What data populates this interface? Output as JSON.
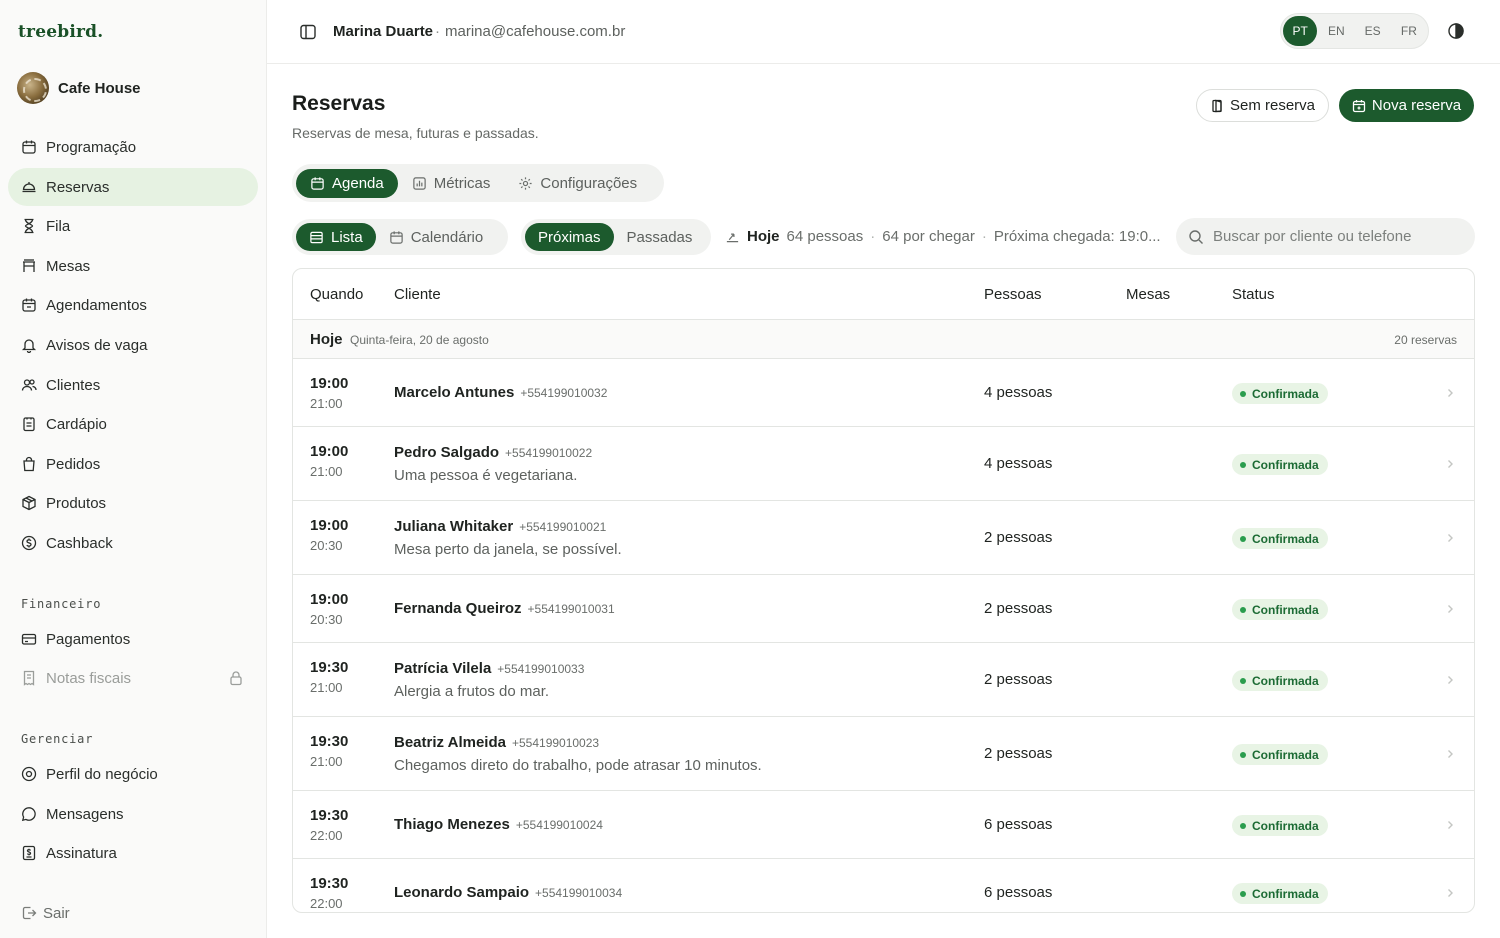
{
  "brand": {
    "logo": "treebird.",
    "business": "Cafe House"
  },
  "user": {
    "name": "Marina Duarte",
    "separator": "·",
    "email": "marina@cafehouse.com.br"
  },
  "languages": [
    {
      "code": "PT",
      "active": true
    },
    {
      "code": "EN",
      "active": false
    },
    {
      "code": "ES",
      "active": false
    },
    {
      "code": "FR",
      "active": false
    }
  ],
  "sidebar": {
    "items": [
      {
        "label": "Programação",
        "icon": "calendar-icon"
      },
      {
        "label": "Reservas",
        "icon": "reservation-icon",
        "active": true
      },
      {
        "label": "Fila",
        "icon": "hourglass-icon"
      },
      {
        "label": "Mesas",
        "icon": "table-icon"
      },
      {
        "label": "Agendamentos",
        "icon": "calendar-clock-icon"
      },
      {
        "label": "Avisos de vaga",
        "icon": "bell-icon"
      },
      {
        "label": "Clientes",
        "icon": "users-icon"
      },
      {
        "label": "Cardápio",
        "icon": "menu-book-icon"
      },
      {
        "label": "Pedidos",
        "icon": "shopping-bag-icon"
      },
      {
        "label": "Produtos",
        "icon": "box-icon"
      },
      {
        "label": "Cashback",
        "icon": "cashback-icon"
      }
    ],
    "finance_label": "Financeiro",
    "finance_items": [
      {
        "label": "Pagamentos",
        "icon": "credit-card-icon"
      },
      {
        "label": "Notas fiscais",
        "icon": "receipt-icon",
        "locked": true
      }
    ],
    "manage_label": "Gerenciar",
    "manage_items": [
      {
        "label": "Perfil do negócio",
        "icon": "location-pin-icon"
      },
      {
        "label": "Mensagens",
        "icon": "chat-icon"
      },
      {
        "label": "Assinatura",
        "icon": "subscription-icon"
      }
    ],
    "logout_label": "Sair"
  },
  "header": {
    "title": "Reservas",
    "subtitle": "Reservas de mesa, futuras e passadas.",
    "walkin_label": "Sem reserva",
    "new_label": "Nova reserva"
  },
  "tabs": [
    {
      "label": "Agenda",
      "icon": "calendar-icon",
      "active": true
    },
    {
      "label": "Métricas",
      "icon": "chart-icon",
      "active": false
    },
    {
      "label": "Configurações",
      "icon": "gear-icon",
      "active": false
    }
  ],
  "view_toggle": {
    "list": "Lista",
    "calendar": "Calendário",
    "active": "list"
  },
  "time_filter": {
    "upcoming": "Próximas",
    "past": "Passadas",
    "active": "upcoming"
  },
  "today_summary": {
    "label": "Hoje",
    "people": "64 pessoas",
    "pending": "64 por chegar",
    "next_arrival": "Próxima chegada: 19:0..."
  },
  "search": {
    "placeholder": "Buscar por cliente ou telefone",
    "value": ""
  },
  "table": {
    "columns": {
      "when": "Quando",
      "client": "Cliente",
      "people": "Pessoas",
      "tables": "Mesas",
      "status": "Status"
    },
    "day": {
      "label": "Hoje",
      "date": "Quinta-feira, 20 de agosto",
      "count": "20 reservas"
    },
    "rows": [
      {
        "start": "19:00",
        "end": "21:00",
        "name": "Marcelo Antunes",
        "phone": "+554199010032",
        "note": "",
        "people": "4 pessoas",
        "status": "Confirmada"
      },
      {
        "start": "19:00",
        "end": "21:00",
        "name": "Pedro Salgado",
        "phone": "+554199010022",
        "note": "Uma pessoa é vegetariana.",
        "people": "4 pessoas",
        "status": "Confirmada"
      },
      {
        "start": "19:00",
        "end": "20:30",
        "name": "Juliana Whitaker",
        "phone": "+554199010021",
        "note": "Mesa perto da janela, se possível.",
        "people": "2 pessoas",
        "status": "Confirmada"
      },
      {
        "start": "19:00",
        "end": "20:30",
        "name": "Fernanda Queiroz",
        "phone": "+554199010031",
        "note": "",
        "people": "2 pessoas",
        "status": "Confirmada"
      },
      {
        "start": "19:30",
        "end": "21:00",
        "name": "Patrícia Vilela",
        "phone": "+554199010033",
        "note": "Alergia a frutos do mar.",
        "people": "2 pessoas",
        "status": "Confirmada"
      },
      {
        "start": "19:30",
        "end": "21:00",
        "name": "Beatriz Almeida",
        "phone": "+554199010023",
        "note": "Chegamos direto do trabalho, pode atrasar 10 minutos.",
        "people": "2 pessoas",
        "status": "Confirmada"
      },
      {
        "start": "19:30",
        "end": "22:00",
        "name": "Thiago Menezes",
        "phone": "+554199010024",
        "note": "",
        "people": "6 pessoas",
        "status": "Confirmada"
      },
      {
        "start": "19:30",
        "end": "22:00",
        "name": "Leonardo Sampaio",
        "phone": "+554199010034",
        "note": "",
        "people": "6 pessoas",
        "status": "Confirmada"
      }
    ]
  },
  "colors": {
    "brand_green": "#1c5a2d",
    "active_nav_bg": "#e6f2e2",
    "status_green": "#2a9d4d"
  }
}
